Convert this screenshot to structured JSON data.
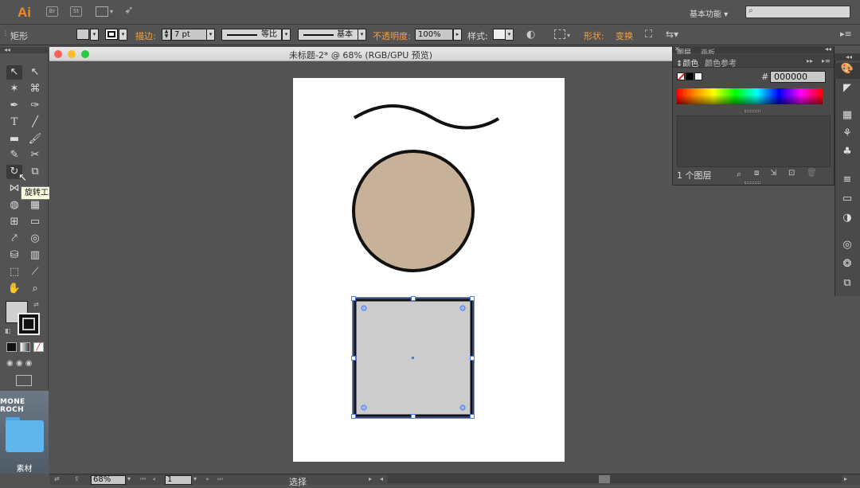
{
  "app": {
    "logo": "Ai",
    "icons": [
      "Br",
      "St"
    ],
    "workspace": "基本功能",
    "search_placeholder": ""
  },
  "control_bar": {
    "selection_type": "矩形",
    "stroke_label": "描边:",
    "stroke_weight": "7 pt",
    "stroke_profile": "等比",
    "brush": "基本",
    "opacity_label": "不透明度:",
    "opacity": "100%",
    "style_label": "样式:",
    "shape_label": "形状:",
    "transform_label": "变换",
    "fill_color": "#cccccc"
  },
  "tools": {
    "tooltip": "旋转工具 (R)",
    "fill_color": "#cfcfcf",
    "stroke_color": "#111111"
  },
  "desktop": {
    "title": "MONE ROCH",
    "folder_label": "素材"
  },
  "document": {
    "title": "未标题-2* @ 68% (RGB/GPU 预览)",
    "circle_fill": "#c7b299",
    "rect_fill": "#cccccc",
    "stroke": "#111111"
  },
  "panel": {
    "top_tabs": [
      "图层",
      "画板"
    ],
    "tab_color": "颜色",
    "tab_color_guide": "颜色参考",
    "hex_label": "#",
    "hex_value": "000000",
    "layers_count": "1 个图层"
  },
  "status_bar": {
    "zoom": "68%",
    "page": "1",
    "tool": "选择"
  }
}
